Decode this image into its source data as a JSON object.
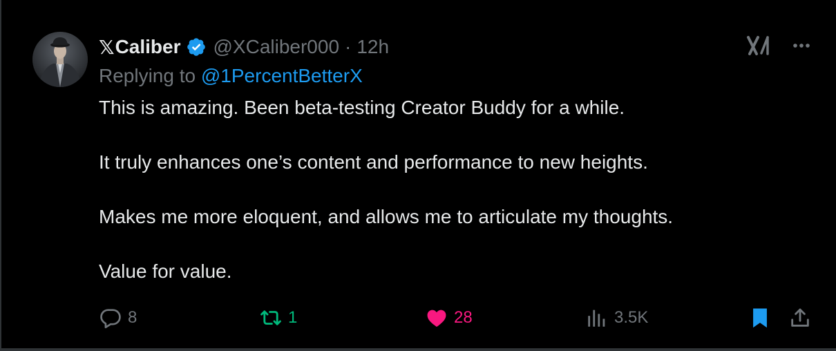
{
  "tweet": {
    "author": {
      "name": "Caliber",
      "name_prefix_icon": "x-logo-icon",
      "handle": "@XCaliber000",
      "verified": true,
      "verified_color": "#1d9bf0",
      "avatar": "profile-photo-man-in-suit"
    },
    "dot": "·",
    "time": "12h",
    "replying": {
      "prefix": "Replying to",
      "handle": "@1PercentBetterX"
    },
    "paragraphs": [
      "This is amazing. Been beta-testing Creator Buddy for a while.",
      "It truly enhances one’s content and performance to new heights.",
      "Makes me more eloquent, and allows me to articulate my thoughts.",
      "Value for value."
    ],
    "actions": {
      "replies": "8",
      "reposts": "1",
      "likes": "28",
      "views": "3.5K"
    },
    "icons": {
      "grok": "grok-icon",
      "more": "more-options-icon",
      "reply": "reply-bubble-icon",
      "retweet": "retweet-icon",
      "like": "heart-icon",
      "views": "analytics-bars-icon",
      "bookmark": "bookmark-icon",
      "share": "share-icon"
    },
    "colors": {
      "background": "#000000",
      "text": "#e7e9ea",
      "secondary": "#71767b",
      "link": "#1d9bf0",
      "repost": "#00ba7c",
      "like": "#f91880",
      "bookmark": "#1d9bf0"
    }
  }
}
